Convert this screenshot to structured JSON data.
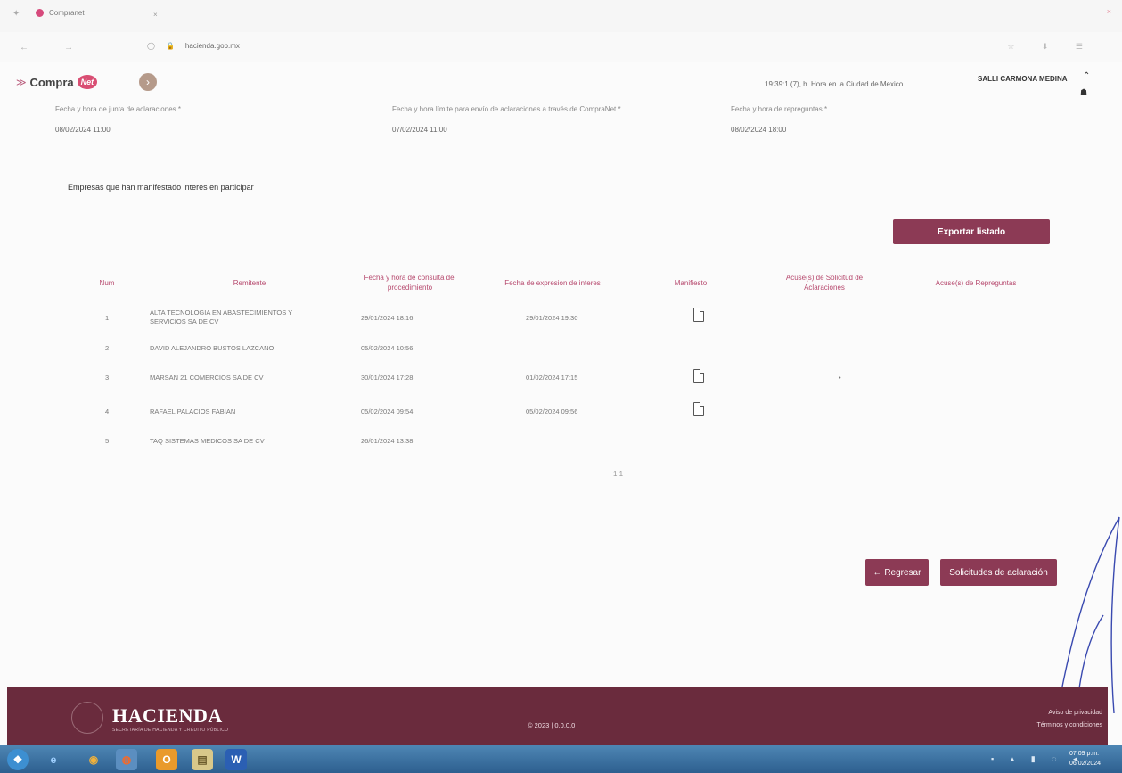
{
  "browser": {
    "tab_title": "Compranet",
    "tab_close": "×",
    "url_parts": [
      "hacienda.gob.mx"
    ],
    "window_close": "×"
  },
  "header": {
    "logo_text": "Compra",
    "logo_net": "Net",
    "logo_mark": "≫",
    "nav_arrow": "›",
    "datetime": "19:39:1 (7), h. Hora en la Ciudad de Mexico",
    "user_name": "SALLI CARMONA MEDINA"
  },
  "fields": [
    {
      "label": "Fecha y hora de junta de aclaraciones *",
      "value": "08/02/2024 11:00"
    },
    {
      "label": "Fecha y hora límite para envío de aclaraciones a través de CompraNet *",
      "value": "07/02/2024 11:00"
    },
    {
      "label": "Fecha y hora de repreguntas *",
      "value": "08/02/2024 18:00"
    }
  ],
  "companies_title": "Empresas que han manifestado interes en participar",
  "export_label": "Exportar listado",
  "table": {
    "headers": [
      "Num",
      "Remitente",
      "Fecha y hora de consulta del procedimiento",
      "Fecha de expresion de interes",
      "Manifiesto",
      "Acuse(s) de Solicitud de Aclaraciones",
      "Acuse(s) de Repreguntas"
    ],
    "rows": [
      {
        "num": "1",
        "remitente": "ALTA TECNOLOGIA EN ABASTECIMIENTOS Y SERVICIOS SA DE CV",
        "consulta": "29/01/2024 18:16",
        "interes": "29/01/2024 19:30",
        "manifiesto": true,
        "acuse": ""
      },
      {
        "num": "2",
        "remitente": "DAVID ALEJANDRO BUSTOS LAZCANO",
        "consulta": "05/02/2024 10:56",
        "interes": "",
        "manifiesto": false,
        "acuse": ""
      },
      {
        "num": "3",
        "remitente": "MARSAN 21 COMERCIOS SA DE CV",
        "consulta": "30/01/2024 17:28",
        "interes": "01/02/2024 17:15",
        "manifiesto": true,
        "acuse": "•"
      },
      {
        "num": "4",
        "remitente": "RAFAEL PALACIOS FABIAN",
        "consulta": "05/02/2024 09:54",
        "interes": "05/02/2024 09:56",
        "manifiesto": true,
        "acuse": ""
      },
      {
        "num": "5",
        "remitente": "TAQ SISTEMAS MEDICOS SA DE CV",
        "consulta": "26/01/2024 13:38",
        "interes": "",
        "manifiesto": false,
        "acuse": ""
      }
    ],
    "pager": "1 1"
  },
  "actions": {
    "back_label": "← Regresar",
    "requests_label": "Solicitudes de aclaración"
  },
  "footer": {
    "brand": "HACIENDA",
    "brand_sub": "SECRETARÍA DE HACIENDA Y CRÉDITO PÚBLICO",
    "copyright": "© 2023 | 0.0.0.0",
    "privacy": "Aviso de privacidad",
    "terms": "Términos y condiciones"
  },
  "taskbar": {
    "time": "07:09 p.m.",
    "date": "06/02/2024"
  },
  "colors": {
    "brand": "#8c3a55",
    "header_text": "#b6486d",
    "footer_bg": "#6a2b3d",
    "taskbar": "#3b6f9f"
  }
}
